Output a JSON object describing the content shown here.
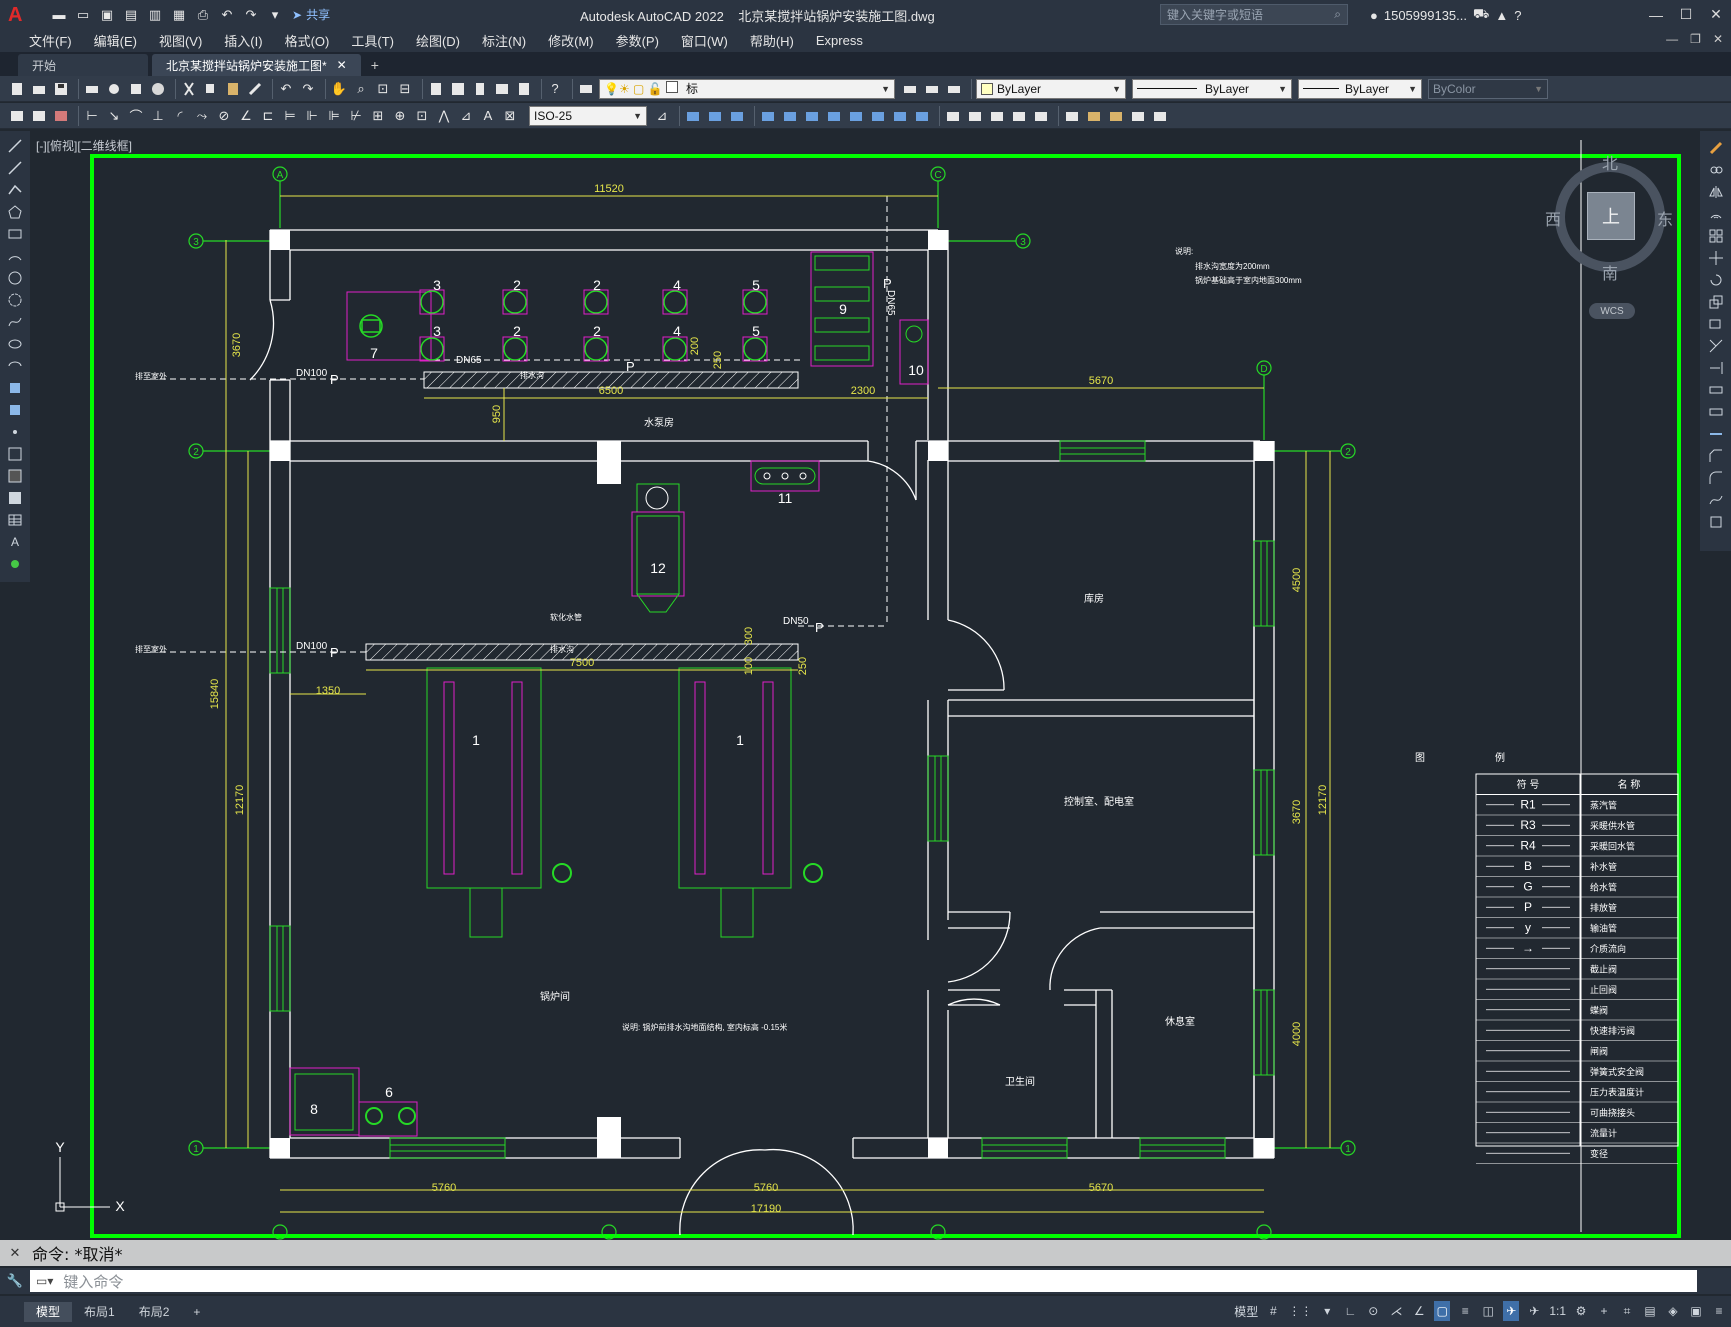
{
  "app": {
    "title": "Autodesk AutoCAD 2022",
    "filename": "北京某搅拌站锅炉安装施工图.dwg",
    "share_label": "共享",
    "search_placeholder": "键入关键字或短语",
    "user": "1505999135..."
  },
  "menu": [
    "文件(F)",
    "编辑(E)",
    "视图(V)",
    "插入(I)",
    "格式(O)",
    "工具(T)",
    "绘图(D)",
    "标注(N)",
    "修改(M)",
    "参数(P)",
    "窗口(W)",
    "帮助(H)",
    "Express"
  ],
  "tabs": [
    {
      "label": "开始"
    },
    {
      "label": "北京某搅拌站锅炉安装施工图*"
    }
  ],
  "toolbar": {
    "layer_name": "标",
    "dimstyle": "ISO-25",
    "color": "ByLayer",
    "linetype": "ByLayer",
    "lineweight": "ByLayer",
    "plotstyle": "ByColor"
  },
  "viewport_label": "[-][俯视][二维线框]",
  "viewcube": {
    "north": "北",
    "south": "南",
    "east": "东",
    "west": "西",
    "face": "上",
    "wcs": "WCS"
  },
  "drawing": {
    "grid_labels": {
      "A": "A",
      "C": "C",
      "D": "D",
      "n1": "1",
      "n2": "2",
      "n3": "3"
    },
    "dims": {
      "top": "11520",
      "right_top": "5670",
      "d3670": "3670",
      "d15840": "15840",
      "d12170": "12170",
      "d6500": "6500",
      "d2300": "2300",
      "d950": "950",
      "d7500": "7500",
      "d1350": "1350",
      "d4500": "4500",
      "d3670b": "3670",
      "d4000": "4000",
      "d12170r": "12170",
      "b5760a": "5760",
      "b5760b": "5760",
      "b5670": "5670",
      "b17190": "17190",
      "d200": "200",
      "d250": "250",
      "d300": "300",
      "d100": "100",
      "d250b": "250"
    },
    "pipes": {
      "dn100a": "DN100",
      "dn100b": "DN100",
      "dn65": "DN65",
      "dn50": "DN50",
      "dn65v": "DN65",
      "p": "P"
    },
    "rooms": {
      "pump": "水泵房",
      "warehouse": "库房",
      "control": "控制室、配电室",
      "rest": "休息室",
      "wc": "卫生间",
      "boiler": "锅炉间"
    },
    "equipment_numbers": [
      "1",
      "1",
      "2",
      "2",
      "2",
      "2",
      "3",
      "3",
      "4",
      "4",
      "5",
      "5",
      "6",
      "7",
      "8",
      "9",
      "10",
      "11",
      "12"
    ],
    "notes": {
      "title": "说明:",
      "line1": "排水沟宽度为200mm",
      "line2": "锅炉基础高于室内地面300mm",
      "boiler_note": "说明: 锅炉前排水沟地面结构, 室内标高 -0.15米",
      "drain_out1": "排至室外",
      "drain_out2": "排至室外",
      "drain1": "排水沟",
      "drain2": "排水沟",
      "softwater": "软化水管"
    },
    "legend": {
      "title_a": "图",
      "title_b": "例",
      "col1": "符 号",
      "col2": "名 称",
      "rows": [
        {
          "sym": "R1",
          "name": "蒸汽管"
        },
        {
          "sym": "R3",
          "name": "采暖供水管"
        },
        {
          "sym": "R4",
          "name": "采暖回水管"
        },
        {
          "sym": "B",
          "name": "补水管"
        },
        {
          "sym": "G",
          "name": "给水管"
        },
        {
          "sym": "P",
          "name": "排放管"
        },
        {
          "sym": "y",
          "name": "输油管"
        },
        {
          "sym": "→",
          "name": "介质流向"
        },
        {
          "sym": "",
          "name": "截止阀"
        },
        {
          "sym": "",
          "name": "止回阀"
        },
        {
          "sym": "",
          "name": "蝶阀"
        },
        {
          "sym": "",
          "name": "快速排污阀"
        },
        {
          "sym": "",
          "name": "闸阀"
        },
        {
          "sym": "",
          "name": "弹簧式安全阀"
        },
        {
          "sym": "",
          "name": "压力表温度计"
        },
        {
          "sym": "",
          "name": "可曲挠接头"
        },
        {
          "sym": "",
          "name": "流量计"
        },
        {
          "sym": "",
          "name": "变径"
        }
      ]
    },
    "ucs": {
      "x": "X",
      "y": "Y"
    }
  },
  "command": {
    "history": "命令: *取消*",
    "placeholder": "键入命令"
  },
  "layouts": [
    "模型",
    "布局1",
    "布局2"
  ],
  "status": {
    "model": "模型",
    "scale": "1:1"
  },
  "colors": {
    "bg": "#212830",
    "wall": "#ffffff",
    "dim": "#e6e64a",
    "green": "#26d926",
    "magenta": "#e020c8",
    "frame": "#00ff00"
  }
}
